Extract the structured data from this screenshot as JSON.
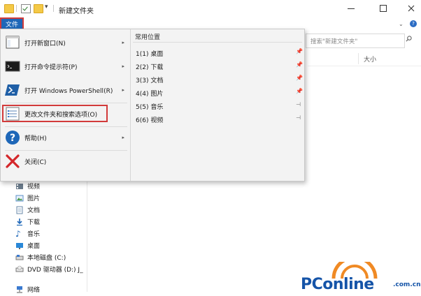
{
  "window": {
    "title": "新建文件夹",
    "quick_access": [
      "folder-icon",
      "properties-check-icon",
      "new-folder-icon",
      "customize-dropdown-icon"
    ]
  },
  "toolbar": {
    "search_placeholder": "搜索\"新建文件夹\"",
    "column_size": "大小"
  },
  "file_menu": {
    "tab_label": "文件",
    "items": [
      {
        "label": "打开新窗口(N)",
        "icon": "new-window-icon",
        "has_submenu": true
      },
      {
        "label": "打开命令提示符(P)",
        "icon": "command-prompt-icon",
        "has_submenu": true
      },
      {
        "label": "打开 Windows PowerShell(R)",
        "icon": "powershell-icon",
        "has_submenu": true
      },
      {
        "label": "更改文件夹和搜索选项(O)",
        "icon": "folder-options-icon",
        "has_submenu": false,
        "highlighted": true
      },
      {
        "label": "帮助(H)",
        "icon": "help-icon",
        "has_submenu": true
      },
      {
        "label": "关闭(C)",
        "icon": "close-x-icon",
        "has_submenu": false
      }
    ],
    "recent": {
      "title": "常用位置",
      "items": [
        {
          "number": "1(1)",
          "name": "桌面",
          "pinned": true
        },
        {
          "number": "2(2)",
          "name": "下载",
          "pinned": true
        },
        {
          "number": "3(3)",
          "name": "文档",
          "pinned": true
        },
        {
          "number": "4(4)",
          "name": "图片",
          "pinned": true
        },
        {
          "number": "5(5)",
          "name": "音乐",
          "pinned": false
        },
        {
          "number": "6(6)",
          "name": "视频",
          "pinned": false
        }
      ]
    }
  },
  "nav_pane": {
    "items": [
      {
        "label": "视频",
        "icon": "videos-icon"
      },
      {
        "label": "图片",
        "icon": "pictures-icon"
      },
      {
        "label": "文档",
        "icon": "documents-icon"
      },
      {
        "label": "下载",
        "icon": "downloads-icon"
      },
      {
        "label": "音乐",
        "icon": "music-icon"
      },
      {
        "label": "桌面",
        "icon": "desktop-icon"
      },
      {
        "label": "本地磁盘 (C:)",
        "icon": "drive-icon"
      },
      {
        "label": "DVD 驱动器 (D:) J_",
        "icon": "dvd-icon"
      },
      {
        "label": "网络",
        "icon": "network-icon"
      }
    ]
  },
  "watermark": {
    "text": "PConline",
    "suffix": ".com.cn"
  },
  "colors": {
    "accent": "#1e67b8",
    "highlight_border": "#d23a3a",
    "watermark": "#1554a8",
    "watermark_arcs": "#f08a24"
  }
}
